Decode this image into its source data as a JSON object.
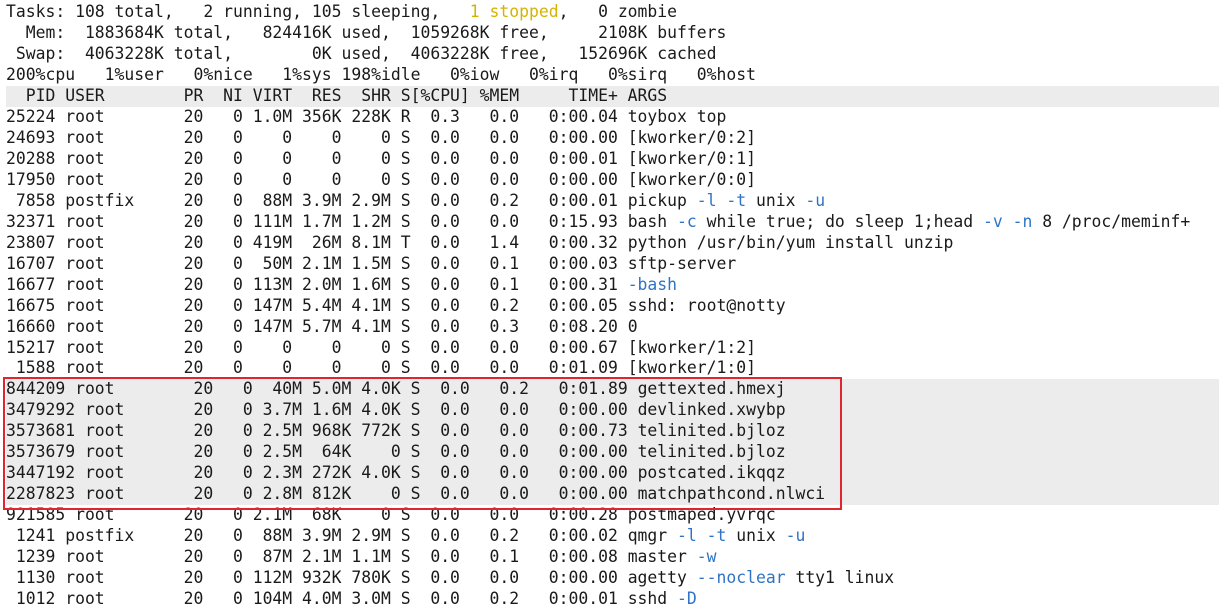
{
  "summary": {
    "tasks": "Tasks: 108 total,   2 running, 105 sleeping,   ",
    "stopped": "1 stopped",
    "tasks_rest": ",   0 zombie",
    "mem": "  Mem:  1883684K total,   824416K used,  1059268K free,     2108K buffers",
    "swap": " Swap:  4063228K total,        0K used,  4063228K free,   152696K cached",
    "cpu": "200%cpu   1%user   0%nice   1%sys 198%idle   0%iow   0%irq   0%sirq   0%host"
  },
  "header": "  PID USER        PR  NI VIRT  RES  SHR S[%CPU] %MEM     TIME+ ARGS",
  "processes": [
    {
      "pre": "25224 root        20   0 1.0M 356K 228K R  0.3   0.0   0:00.04 ",
      "args": [
        {
          "t": "toybox top"
        }
      ]
    },
    {
      "pre": "24693 root        20   0    0    0    0 S  0.0   0.0   0:00.00 ",
      "args": [
        {
          "t": "[kworker/0:2]"
        }
      ]
    },
    {
      "pre": "20288 root        20   0    0    0    0 S  0.0   0.0   0:00.01 ",
      "args": [
        {
          "t": "[kworker/0:1]"
        }
      ]
    },
    {
      "pre": "17950 root        20   0    0    0    0 S  0.0   0.0   0:00.00 ",
      "args": [
        {
          "t": "[kworker/0:0]"
        }
      ]
    },
    {
      "pre": " 7858 postfix     20   0  88M 3.9M 2.9M S  0.0   0.2   0:00.01 ",
      "args": [
        {
          "t": "pickup "
        },
        {
          "t": "-l",
          "o": true
        },
        {
          "t": " "
        },
        {
          "t": "-t",
          "o": true
        },
        {
          "t": " unix "
        },
        {
          "t": "-u",
          "o": true
        }
      ]
    },
    {
      "pre": "32371 root        20   0 111M 1.7M 1.2M S  0.0   0.0   0:15.93 ",
      "args": [
        {
          "t": "bash "
        },
        {
          "t": "-c",
          "o": true
        },
        {
          "t": " while true; do sleep 1;head "
        },
        {
          "t": "-v",
          "o": true
        },
        {
          "t": " "
        },
        {
          "t": "-n",
          "o": true
        },
        {
          "t": " 8 /proc/meminf+"
        }
      ]
    },
    {
      "pre": "23807 root        20   0 419M  26M 8.1M T  0.0   1.4   0:00.32 ",
      "args": [
        {
          "t": "python /usr/bin/yum install unzip"
        }
      ]
    },
    {
      "pre": "16707 root        20   0  50M 2.1M 1.5M S  0.0   0.1   0:00.03 ",
      "args": [
        {
          "t": "sftp-server"
        }
      ]
    },
    {
      "pre": "16677 root        20   0 113M 2.0M 1.6M S  0.0   0.1   0:00.31 ",
      "args": [
        {
          "t": "-bash",
          "o": true
        }
      ]
    },
    {
      "pre": "16675 root        20   0 147M 5.4M 4.1M S  0.0   0.2   0:00.05 ",
      "args": [
        {
          "t": "sshd: root@notty"
        }
      ]
    },
    {
      "pre": "16660 root        20   0 147M 5.7M 4.1M S  0.0   0.3   0:08.20 ",
      "args": [
        {
          "t": "0"
        }
      ]
    },
    {
      "pre": "15217 root        20   0    0    0    0 S  0.0   0.0   0:00.67 ",
      "args": [
        {
          "t": "[kworker/1:2]"
        }
      ]
    },
    {
      "pre": " 1588 root        20   0    0    0    0 S  0.0   0.0   0:01.09 ",
      "args": [
        {
          "t": "[kworker/1:0]"
        }
      ]
    },
    {
      "pre": "844209 root        20   0  40M 5.0M 4.0K S  0.0   0.2   0:01.89 ",
      "args": [
        {
          "t": "gettexted.hmexj"
        }
      ],
      "hl": true
    },
    {
      "pre": "3479292 root       20   0 3.7M 1.6M 4.0K S  0.0   0.0   0:00.00 ",
      "args": [
        {
          "t": "devlinked.xwybp"
        }
      ],
      "hl": true
    },
    {
      "pre": "3573681 root       20   0 2.5M 968K 772K S  0.0   0.0   0:00.73 ",
      "args": [
        {
          "t": "telinited.bjloz"
        }
      ],
      "hl": true
    },
    {
      "pre": "3573679 root       20   0 2.5M  64K    0 S  0.0   0.0   0:00.00 ",
      "args": [
        {
          "t": "telinited.bjloz"
        }
      ],
      "hl": true
    },
    {
      "pre": "3447192 root       20   0 2.3M 272K 4.0K S  0.0   0.0   0:00.00 ",
      "args": [
        {
          "t": "postcated.ikqqz"
        }
      ],
      "hl": true
    },
    {
      "pre": "2287823 root       20   0 2.8M 812K    0 S  0.0   0.0   0:00.00 ",
      "args": [
        {
          "t": "matchpathcond.nlwci"
        }
      ],
      "hl": true
    },
    {
      "pre": "921585 root       20   0 2.1M  68K    0 S  0.0   0.0   0:00.28 ",
      "args": [
        {
          "t": "postmaped.yvrqc"
        }
      ]
    },
    {
      "pre": " 1241 postfix     20   0  88M 3.9M 2.9M S  0.0   0.2   0:00.02 ",
      "args": [
        {
          "t": "qmgr "
        },
        {
          "t": "-l",
          "o": true
        },
        {
          "t": " "
        },
        {
          "t": "-t",
          "o": true
        },
        {
          "t": " unix "
        },
        {
          "t": "-u",
          "o": true
        }
      ]
    },
    {
      "pre": " 1239 root        20   0  87M 2.1M 1.1M S  0.0   0.1   0:00.08 ",
      "args": [
        {
          "t": "master "
        },
        {
          "t": "-w",
          "o": true
        }
      ]
    },
    {
      "pre": " 1130 root        20   0 112M 932K 780K S  0.0   0.0   0:00.00 ",
      "args": [
        {
          "t": "agetty "
        },
        {
          "t": "--noclear",
          "o": true
        },
        {
          "t": " tty1 linux"
        }
      ]
    },
    {
      "pre": " 1012 root        20   0 104M 4.0M 3.0M S  0.0   0.2   0:00.01 ",
      "args": [
        {
          "t": "sshd "
        },
        {
          "t": "-D",
          "o": true
        }
      ]
    }
  ],
  "colors": {
    "stopped": "#d4b400",
    "option": "#2f74c4",
    "highlight_border": "#e0252f",
    "header_bg": "#ececec"
  }
}
